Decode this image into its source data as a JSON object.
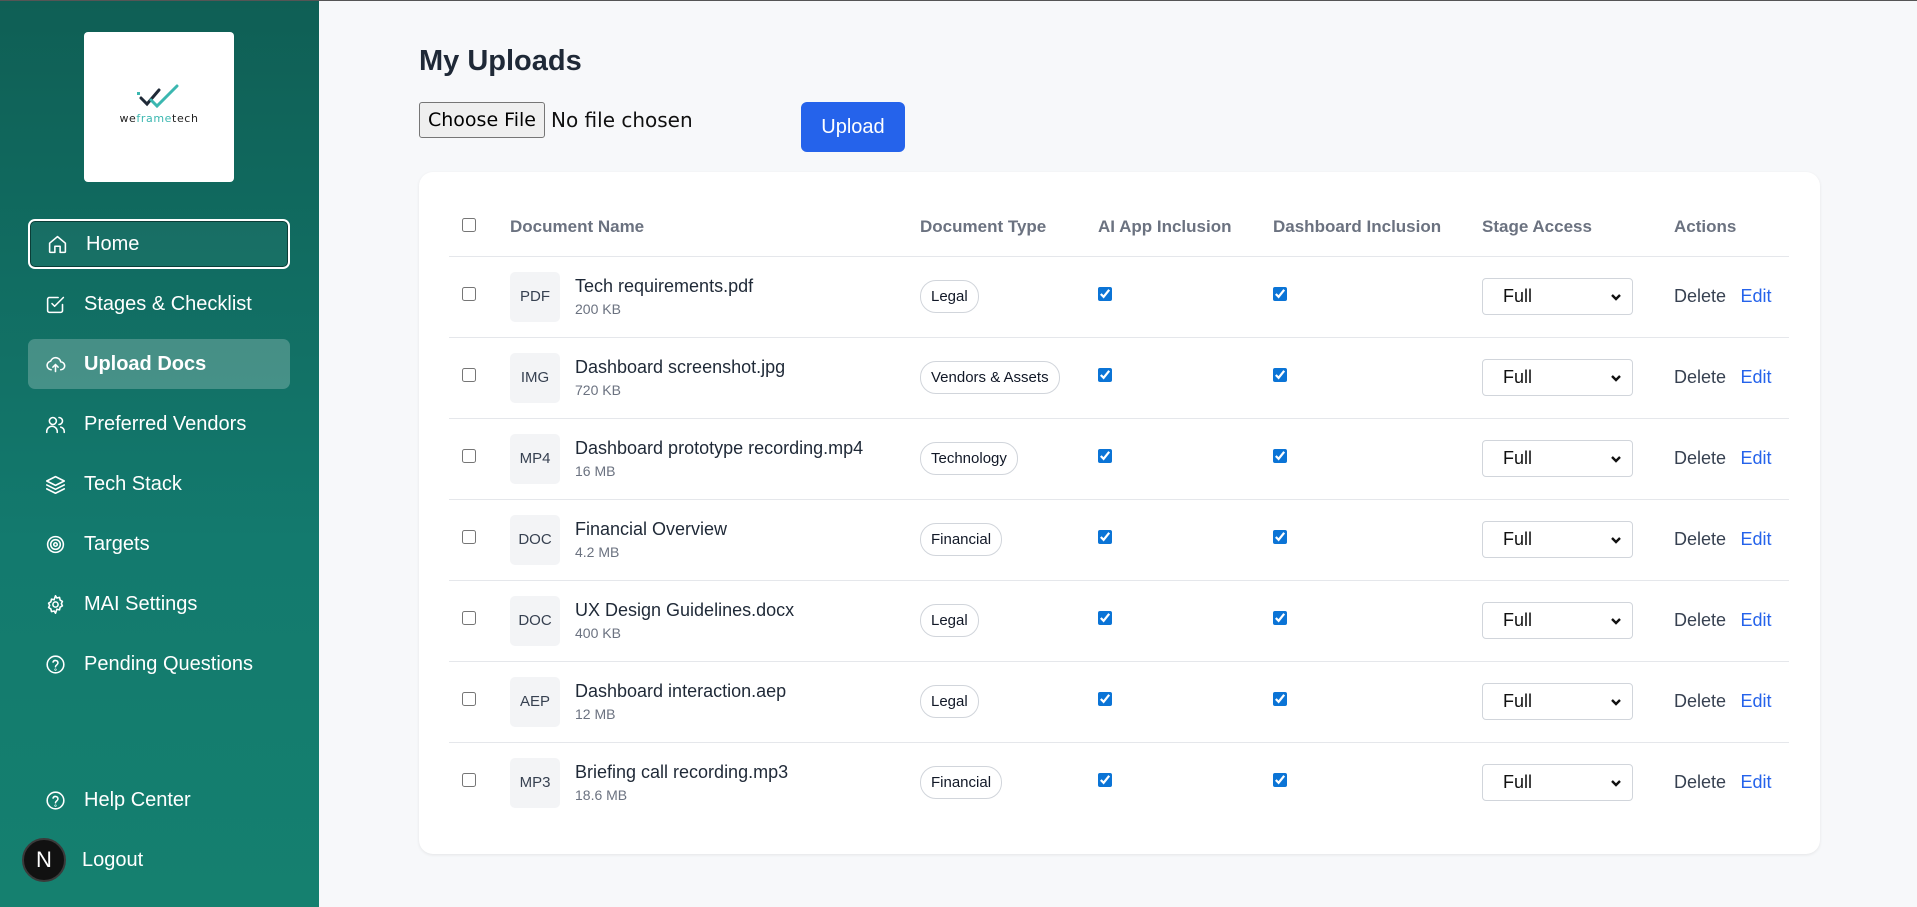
{
  "logo": {
    "text_prefix": "we",
    "text_accent": "frame",
    "text_suffix": "tech"
  },
  "sidebar": {
    "items": [
      {
        "label": "Home",
        "icon": "home-icon"
      },
      {
        "label": "Stages & Checklist",
        "icon": "checklist-icon"
      },
      {
        "label": "Upload Docs",
        "icon": "cloud-upload-icon",
        "active": true
      },
      {
        "label": "Preferred Vendors",
        "icon": "users-icon"
      },
      {
        "label": "Tech Stack",
        "icon": "layers-icon"
      },
      {
        "label": "Targets",
        "icon": "target-icon"
      },
      {
        "label": "MAI Settings",
        "icon": "gear-icon"
      },
      {
        "label": "Pending Questions",
        "icon": "help-circle-icon"
      }
    ],
    "help_label": "Help Center",
    "logout_label": "Logout",
    "avatar_letter": "N"
  },
  "main": {
    "title": "My Uploads",
    "choose_file_label": "Choose File",
    "no_file_text": "No file chosen",
    "upload_label": "Upload"
  },
  "table": {
    "headers": {
      "name": "Document Name",
      "type": "Document Type",
      "ai": "AI App Inclusion",
      "dashboard": "Dashboard Inclusion",
      "stage": "Stage Access",
      "actions": "Actions"
    },
    "delete_label": "Delete",
    "edit_label": "Edit",
    "rows": [
      {
        "ext": "PDF",
        "name": "Tech requirements.pdf",
        "size": "200 KB",
        "type": "Legal",
        "ai": true,
        "dashboard": true,
        "stage": "Full"
      },
      {
        "ext": "IMG",
        "name": "Dashboard screenshot.jpg",
        "size": "720 KB",
        "type": "Vendors & Assets",
        "ai": true,
        "dashboard": true,
        "stage": "Full"
      },
      {
        "ext": "MP4",
        "name": "Dashboard prototype recording.mp4",
        "size": "16 MB",
        "type": "Technology",
        "ai": true,
        "dashboard": true,
        "stage": "Full"
      },
      {
        "ext": "DOC",
        "name": "Financial Overview",
        "size": "4.2 MB",
        "type": "Financial",
        "ai": true,
        "dashboard": true,
        "stage": "Full"
      },
      {
        "ext": "DOC",
        "name": "UX Design Guidelines.docx",
        "size": "400 KB",
        "type": "Legal",
        "ai": true,
        "dashboard": true,
        "stage": "Full"
      },
      {
        "ext": "AEP",
        "name": "Dashboard interaction.aep",
        "size": "12 MB",
        "type": "Legal",
        "ai": true,
        "dashboard": true,
        "stage": "Full"
      },
      {
        "ext": "MP3",
        "name": "Briefing call recording.mp3",
        "size": "18.6 MB",
        "type": "Financial",
        "ai": true,
        "dashboard": true,
        "stage": "Full"
      }
    ]
  },
  "colors": {
    "sidebar_top": "#0f5f55",
    "sidebar_bottom": "#15806f",
    "primary": "#2563eb",
    "checkbox": "#0b74d6"
  }
}
